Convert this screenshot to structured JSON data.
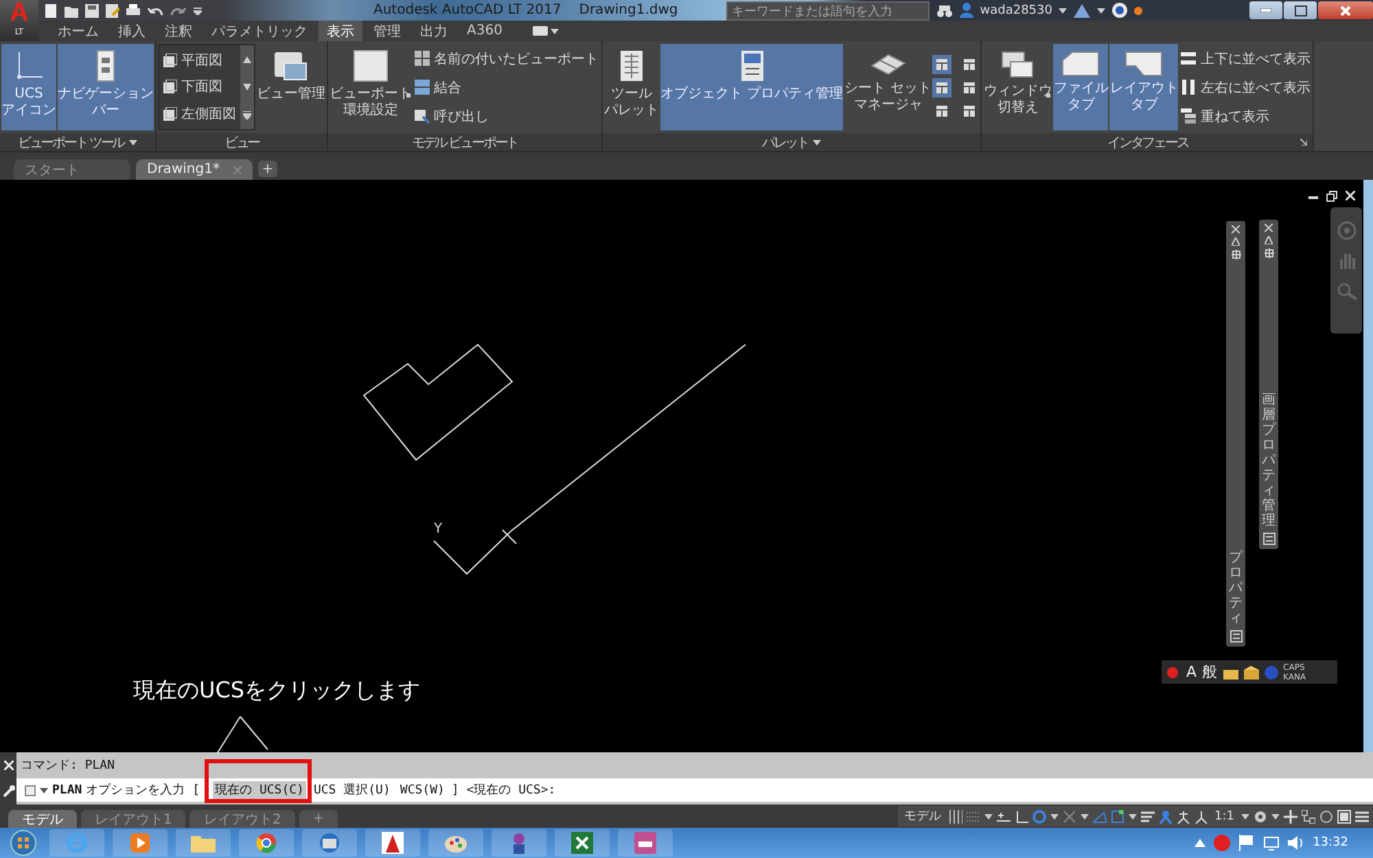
{
  "title_bar": {
    "app_letter": "A",
    "app_edition": "LT",
    "title": "Autodesk AutoCAD LT 2017",
    "document": "Drawing1.dwg",
    "search_placeholder": "キーワードまたは語句を入力",
    "user": "wada28530"
  },
  "menu_tabs": [
    {
      "label": "ホーム",
      "selected": false
    },
    {
      "label": "挿入",
      "selected": false
    },
    {
      "label": "注釈",
      "selected": false
    },
    {
      "label": "パラメトリック",
      "selected": false
    },
    {
      "label": "表示",
      "selected": true
    },
    {
      "label": "管理",
      "selected": false
    },
    {
      "label": "出力",
      "selected": false
    },
    {
      "label": "A360",
      "selected": false
    }
  ],
  "ribbon_panels": [
    {
      "title": "ビューポート ツール",
      "dropdown": true,
      "items": [
        {
          "kind": "large",
          "lines": [
            "UCS",
            "アイコン"
          ],
          "selected": true
        },
        {
          "kind": "large",
          "lines": [
            "ナビゲーション",
            "バー"
          ],
          "selected": true
        }
      ]
    },
    {
      "title": "ビュー",
      "items": [
        {
          "kind": "gallery",
          "entries": [
            "平面図",
            "下面図",
            "左側面図"
          ]
        },
        {
          "kind": "large",
          "lines": [
            "ビュー管理"
          ],
          "selected": false
        }
      ]
    },
    {
      "title": "モデル ビューポート",
      "items": [
        {
          "kind": "large",
          "lines": [
            "ビューポート",
            "環境設定"
          ],
          "selected": false,
          "dropdown": true
        },
        {
          "kind": "small_list",
          "entries": [
            "名前の付いたビューポート",
            "結合",
            "呼び出し"
          ]
        }
      ]
    },
    {
      "title": "パレット",
      "dropdown": true,
      "items": [
        {
          "kind": "large",
          "lines": [
            "ツール",
            "パレット"
          ],
          "selected": false
        },
        {
          "kind": "large",
          "lines": [
            "オブジェクト プロパティ管理"
          ],
          "selected": true
        },
        {
          "kind": "large",
          "lines": [
            "シート セット",
            "マネージャ"
          ],
          "selected": false
        },
        {
          "kind": "icon_grid",
          "buttons": [
            {
              "selected": true
            },
            {
              "selected": false
            },
            {
              "selected": true
            },
            {
              "selected": false
            },
            {
              "selected": false
            },
            {
              "selected": false
            }
          ]
        }
      ]
    },
    {
      "title": "インタフェース",
      "launcher": true,
      "items": [
        {
          "kind": "large",
          "lines": [
            "ウィンドウ",
            "切替え"
          ],
          "selected": false,
          "dropdown": true
        },
        {
          "kind": "large",
          "lines": [
            "ファイル",
            "タブ"
          ],
          "selected": true
        },
        {
          "kind": "large",
          "lines": [
            "レイアウト",
            "タブ"
          ],
          "selected": true
        },
        {
          "kind": "small_list",
          "entries": [
            "上下に並べて表示",
            "左右に並べて表示",
            "重ねて表示"
          ]
        }
      ]
    }
  ],
  "document_tabs": [
    {
      "label": "スタート",
      "selected": false,
      "closable": false
    },
    {
      "label": "Drawing1*",
      "selected": true,
      "closable": true
    }
  ],
  "new_tab": "+",
  "canvas": {
    "axis_label": "Y",
    "annotation": "現在のUCSをクリックします"
  },
  "palettes": [
    {
      "title": "プロパティ"
    },
    {
      "title": "画層プロパティ管理"
    }
  ],
  "language_bar": {
    "mode": "A",
    "dictionary": "般",
    "caps": "CAPS",
    "kana": "KANA"
  },
  "command": {
    "history": "コマンド: PLAN",
    "prompt_command": "PLAN",
    "prompt_text": "オプションを入力 [",
    "options": [
      {
        "label": "現在の UCS(C)",
        "selected": true
      },
      {
        "label": "UCS 選択(U)",
        "selected": false
      },
      {
        "label": "WCS(W)",
        "selected": false
      }
    ],
    "prompt_default": "] <現在の UCS>:"
  },
  "layout_tabs": [
    {
      "label": "モデル",
      "selected": true
    },
    {
      "label": "レイアウト1",
      "selected": false
    },
    {
      "label": "レイアウト2",
      "selected": false
    }
  ],
  "add_layout": "+",
  "status_bar": {
    "model": "モデル",
    "scale": "1:1"
  },
  "taskbar": {
    "clock": "13:32"
  }
}
